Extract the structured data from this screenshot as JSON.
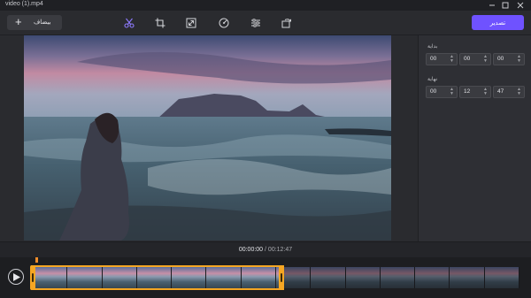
{
  "window": {
    "title": "video (1).mp4"
  },
  "toolbar": {
    "add_label": "بيضاف",
    "tools": [
      "scissors-icon",
      "crop-icon",
      "resize-icon",
      "speed-icon",
      "adjust-icon",
      "rotate-icon"
    ],
    "active_tool": "scissors-icon",
    "export_label": "تصدير"
  },
  "trim": {
    "start_label": "بداية",
    "end_label": "نهاية",
    "start": {
      "h": "00",
      "m": "00",
      "s": "00"
    },
    "end": {
      "h": "00",
      "m": "12",
      "s": "47"
    }
  },
  "player": {
    "current_time": "00:00:00",
    "separator": " / ",
    "total_time": "00:12:47"
  },
  "colors": {
    "accent": "#6f52ff",
    "active_tool": "#8e7bff",
    "trim_handle": "#f5a623",
    "playhead": "#f08d2a"
  },
  "timeline": {
    "frame_count": 14,
    "selection_start_fraction": 0,
    "selection_end_fraction": 0.51
  }
}
